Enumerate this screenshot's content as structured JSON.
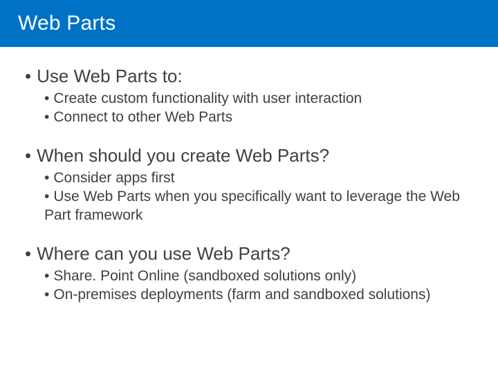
{
  "slide": {
    "title": "Web Parts",
    "sections": [
      {
        "heading": "Use Web Parts to:",
        "items": [
          "Create custom functionality with user interaction",
          "Connect to other Web Parts"
        ]
      },
      {
        "heading": "When should you create Web Parts?",
        "items": [
          "Consider apps first",
          "Use Web Parts when you specifically want to leverage the Web Part framework"
        ]
      },
      {
        "heading": "Where can you use Web Parts?",
        "items": [
          "Share. Point Online (sandboxed solutions only)",
          "On-premises deployments (farm and sandboxed solutions)"
        ]
      }
    ]
  },
  "colors": {
    "brand": "#0072c6",
    "text": "#404040"
  }
}
